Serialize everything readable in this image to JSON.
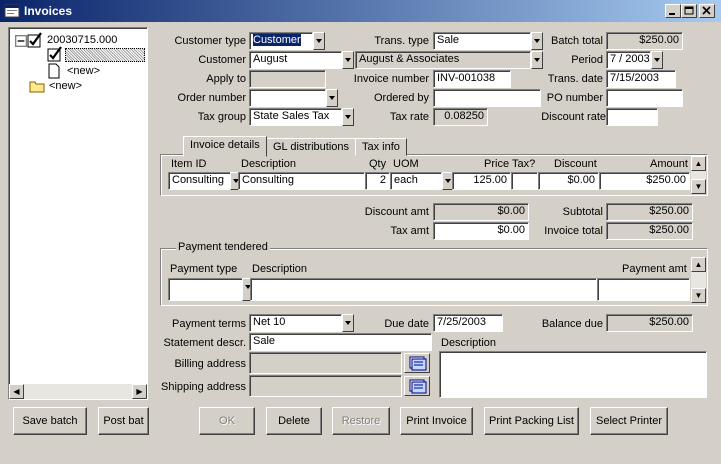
{
  "window": {
    "title": "Invoices",
    "controls": [
      "minimize",
      "maximize",
      "close"
    ]
  },
  "tree": {
    "root_label": "20030715.000",
    "child_new_label": "<new>",
    "root_new_label": "<new>"
  },
  "left_buttons": {
    "save_batch": "Save batch",
    "post_batch": "Post bat"
  },
  "header": {
    "customer_type_label": "Customer type",
    "customer_type_value": "Customer",
    "customer_label": "Customer",
    "customer_id": "August",
    "customer_name": "August & Associates",
    "apply_to_label": "Apply to",
    "apply_to_value": "",
    "order_number_label": "Order number",
    "order_number_value": "",
    "tax_group_label": "Tax group",
    "tax_group_value": "State Sales Tax",
    "trans_type_label": "Trans. type",
    "trans_type_value": "Sale",
    "invoice_number_label": "Invoice number",
    "invoice_number_value": "INV-001038",
    "ordered_by_label": "Ordered by",
    "ordered_by_value": "",
    "tax_rate_label": "Tax rate",
    "tax_rate_value": "0.08250",
    "batch_total_label": "Batch total",
    "batch_total_value": "$250.00",
    "period_label": "Period",
    "period_value": "7 / 2003",
    "trans_date_label": "Trans. date",
    "trans_date_value": "7/15/2003",
    "po_number_label": "PO number",
    "po_number_value": "",
    "discount_rate_label": "Discount rate",
    "discount_rate_value": ""
  },
  "tabs": [
    {
      "label": "Invoice details",
      "active": true
    },
    {
      "label": "GL distributions",
      "active": false
    },
    {
      "label": "Tax info",
      "active": false
    }
  ],
  "details_grid": {
    "columns": [
      "Item ID",
      "Description",
      "Qty",
      "UOM",
      "Price",
      "Tax?",
      "Discount",
      "Amount"
    ],
    "rows": [
      {
        "item_id": "Consulting",
        "description": "Consulting",
        "qty": "2",
        "uom": "each",
        "price": "125.00",
        "tax": "",
        "discount": "$0.00",
        "amount": "$250.00"
      }
    ]
  },
  "totals": {
    "discount_amt_label": "Discount amt",
    "discount_amt_value": "$0.00",
    "tax_amt_label": "Tax amt",
    "tax_amt_value": "$0.00",
    "subtotal_label": "Subtotal",
    "subtotal_value": "$250.00",
    "invoice_total_label": "Invoice total",
    "invoice_total_value": "$250.00"
  },
  "payment": {
    "legend": "Payment tendered",
    "columns": [
      "Payment type",
      "Description",
      "Payment amt"
    ]
  },
  "footer": {
    "payment_terms_label": "Payment terms",
    "payment_terms_value": "Net 10",
    "due_date_label": "Due date",
    "due_date_value": "7/25/2003",
    "balance_due_label": "Balance due",
    "balance_due_value": "$250.00",
    "statement_descr_label": "Statement descr.",
    "statement_descr_value": "Sale",
    "billing_address_label": "Billing address",
    "billing_address_value": "",
    "shipping_address_label": "Shipping address",
    "shipping_address_value": "",
    "description_label": "Description",
    "description_value": ""
  },
  "actions": {
    "ok": "OK",
    "delete": "Delete",
    "restore": "Restore",
    "print_invoice": "Print Invoice",
    "print_packing_list": "Print Packing List",
    "select_printer": "Select Printer"
  },
  "colors": {
    "titlebar_start": "#0a246a",
    "titlebar_end": "#a6caf0",
    "face": "#d4d0c8",
    "selection": "#0a246a"
  }
}
